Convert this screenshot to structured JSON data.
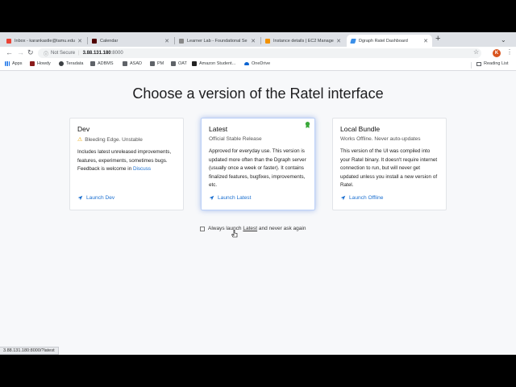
{
  "tabs": [
    {
      "label": "Inbox - karankastle@tamu.edu",
      "favicon": "gmail-icon",
      "color": "#ea4335",
      "active": false
    },
    {
      "label": "Calendar",
      "favicon": "tamu-icon",
      "color": "#500000",
      "active": false
    },
    {
      "label": "Learner Lab - Foundational Se",
      "favicon": "aws-academy-icon",
      "color": "#888888",
      "active": false
    },
    {
      "label": "Instance details | EC2 Manage",
      "favicon": "ec2-icon",
      "color": "#f29100",
      "active": false
    },
    {
      "label": "Dgraph Ratel Dashboard",
      "favicon": "dgraph-icon",
      "color": "#3b8fe8",
      "active": true
    }
  ],
  "address": {
    "security": "Not Secure",
    "host": "3.88.131.180",
    "port": ":8000"
  },
  "profile_initial": "K",
  "bookmarks": [
    {
      "label": "Apps",
      "icon": "apps-grid-icon"
    },
    {
      "label": "Howdy",
      "icon": "howdy-icon"
    },
    {
      "label": "Teradata",
      "icon": "teradata-icon"
    },
    {
      "label": "ADBMS",
      "icon": "folder-icon"
    },
    {
      "label": "ASAD",
      "icon": "folder-icon"
    },
    {
      "label": "PM",
      "icon": "folder-icon"
    },
    {
      "label": "OAT",
      "icon": "folder-icon"
    },
    {
      "label": "Amazon Student...",
      "icon": "amazon-icon"
    },
    {
      "label": "OneDrive",
      "icon": "onedrive-icon"
    }
  ],
  "reading_list": "Reading List",
  "page": {
    "title": "Choose a version of the Ratel interface",
    "cards": [
      {
        "title": "Dev",
        "subtitle": "Bleeding Edge. Unstable",
        "text": "Includes latest unreleased improvements, features, experiments, sometimes bugs. Feedback is welcome in",
        "link": "Discuss",
        "launch": "Launch Dev"
      },
      {
        "title": "Latest",
        "subtitle": "Official Stable Release",
        "text": "Approved for everyday use. This version is updated more often than the Dgraph server (usually once a week or faster). It contains finalized features, bugfixes, improvements, etc.",
        "launch": "Launch Latest"
      },
      {
        "title": "Local Bundle",
        "subtitle": "Works Offline. Never auto-updates",
        "text": "This version of the UI was compiled into your Ratel binary. It doesn't require internet connection to run, but will never get updated unless you install a new version of Ratel.",
        "launch": "Launch Offline"
      }
    ],
    "always": {
      "prefix": "Always launch",
      "link": "Latest",
      "suffix": "and never ask again"
    }
  },
  "status_url": "3.88.131.180:8000/?latest",
  "colors": {
    "accent": "#1a6fd0",
    "warning": "#e6a400",
    "highlight": "#bcd0f7",
    "badge": "#3aa83a"
  }
}
